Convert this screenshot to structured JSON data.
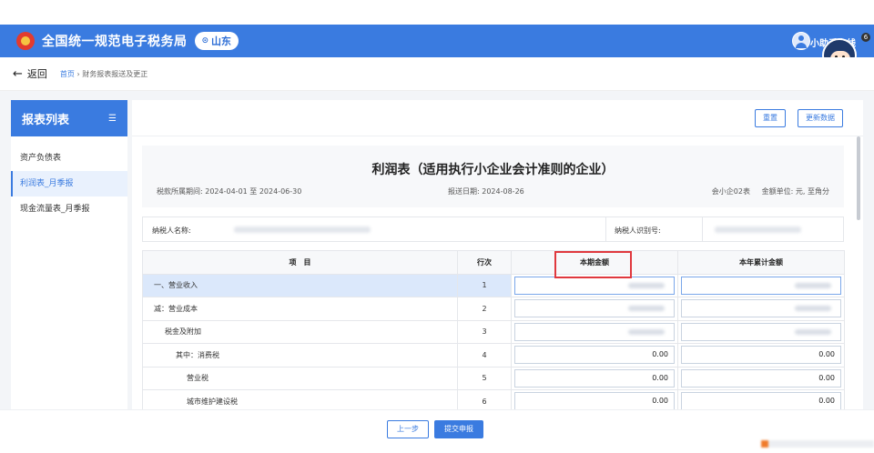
{
  "header": {
    "site_title": "全国统一规范电子税务局",
    "region": "山东",
    "helper_text": "小助手在线",
    "mascot_badge": "6"
  },
  "subbar": {
    "back_label": "返回",
    "crumb_home": "首页",
    "crumb_sep": "›",
    "crumb_current": "财务报表报送及更正"
  },
  "sidebar": {
    "title": "报表列表",
    "items": [
      {
        "label": "资产负债表"
      },
      {
        "label": "利润表_月季报"
      },
      {
        "label": "现金流量表_月季报"
      }
    ]
  },
  "toolbar": {
    "reset_label": "重置",
    "update_label": "更新数据"
  },
  "report": {
    "title": "利润表（适用执行小企业会计准则的企业）",
    "period_label": "税款所属期间:",
    "period_start": "2024-04-01",
    "period_to": "至",
    "period_end": "2024-06-30",
    "date_label": "报送日期:",
    "date_value": "2024-08-26",
    "form_code": "会小企02表",
    "unit": "金额单位: 元, 至角分"
  },
  "taxpayer": {
    "name_label": "纳税人名称:",
    "id_label": "纳税人识别号:"
  },
  "table": {
    "headers": {
      "item": "项　目",
      "rowno": "行次",
      "current": "本期金额",
      "ytd": "本年累计金额"
    },
    "rows": [
      {
        "item": "一、营业收入",
        "rowno": "1",
        "current": "",
        "ytd": ""
      },
      {
        "item": "减：营业成本",
        "rowno": "2",
        "current": "",
        "ytd": ""
      },
      {
        "item": "税金及附加",
        "rowno": "3",
        "current": "",
        "ytd": ""
      },
      {
        "item": "其中：消费税",
        "rowno": "4",
        "current": "0.00",
        "ytd": "0.00"
      },
      {
        "item": "营业税",
        "rowno": "5",
        "current": "0.00",
        "ytd": "0.00"
      },
      {
        "item": "城市维护建设税",
        "rowno": "6",
        "current": "0.00",
        "ytd": "0.00"
      }
    ]
  },
  "footer": {
    "prev_label": "上一步",
    "submit_label": "提交申报"
  }
}
